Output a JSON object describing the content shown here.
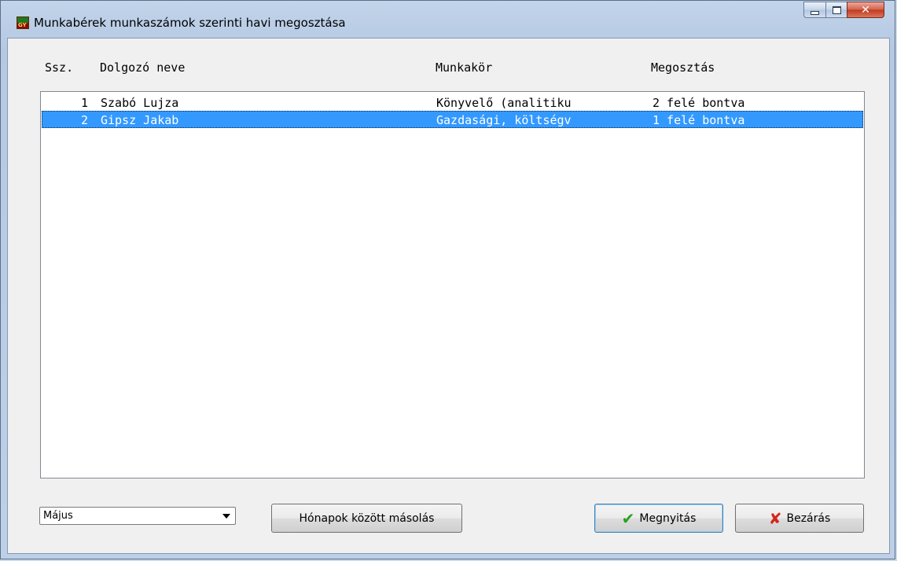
{
  "window": {
    "title": "Munkabérek munkaszámok szerinti havi megosztása",
    "app_icon_text": "GY"
  },
  "columns": {
    "ssz": "Ssz.",
    "name": "Dolgozó neve",
    "job": "Munkakör",
    "split": "Megosztás"
  },
  "rows": [
    {
      "no": "1",
      "name": "Szabó Lujza",
      "job": "Könyvelő (analitiku",
      "split": "2 felé bontva",
      "selected": false
    },
    {
      "no": "2",
      "name": "Gipsz Jakab",
      "job": "Gazdasági, költségv",
      "split": "1 felé bontva",
      "selected": true
    }
  ],
  "month_select": {
    "value": "Május"
  },
  "buttons": {
    "copy": "Hónapok között másolás",
    "open": "Megnyitás",
    "close": "Bezárás"
  },
  "colors": {
    "selection": "#3399ff",
    "open_icon": "#27a11e",
    "close_icon": "#d4261c"
  },
  "icons": [
    "check-icon",
    "cross-icon",
    "dropdown-arrow-icon"
  ]
}
